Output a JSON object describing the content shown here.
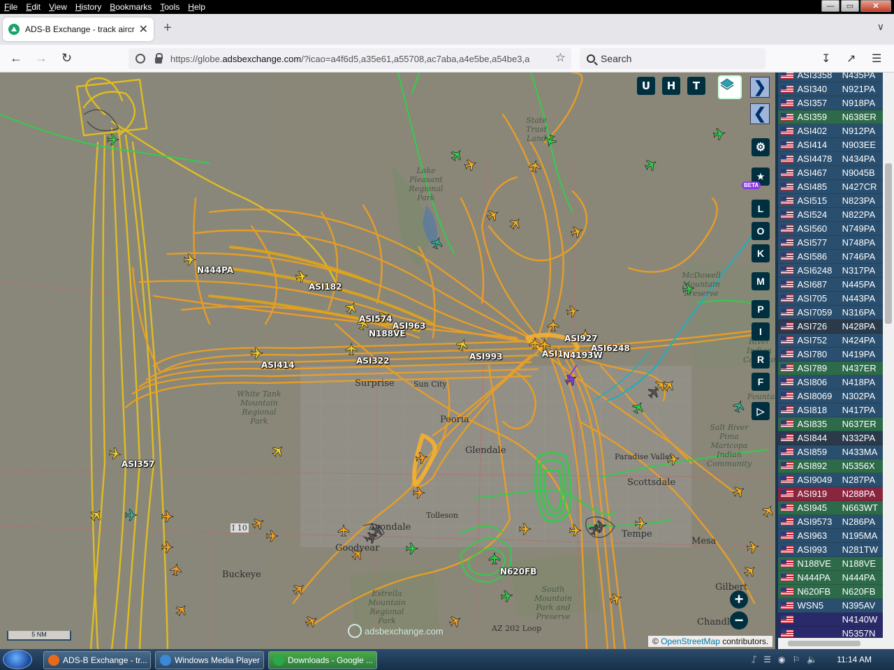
{
  "menubar": {
    "items": [
      "File",
      "Edit",
      "View",
      "History",
      "Bookmarks",
      "Tools",
      "Help"
    ]
  },
  "window_controls": {
    "minimize": "—",
    "maximize": "▭",
    "close": "✕"
  },
  "tab": {
    "title": "ADS-B Exchange - track aircraft",
    "close": "✕"
  },
  "newtab": "+",
  "navbar": {
    "url_prefix": "https://globe.",
    "url_domain": "adsbexchange.com",
    "url_rest": "/?icao=a4f6d5,a35e61,a55708,ac7aba,a4e5be,a54be3,a",
    "search_placeholder": "Search"
  },
  "map": {
    "places": [
      {
        "name": "Surprise",
        "cls": ""
      },
      {
        "name": "Glendale",
        "cls": ""
      },
      {
        "name": "Peoria",
        "cls": ""
      },
      {
        "name": "Scottsdale",
        "cls": ""
      },
      {
        "name": "Tempe",
        "cls": ""
      },
      {
        "name": "Mesa",
        "cls": ""
      },
      {
        "name": "Gilbert",
        "cls": ""
      },
      {
        "name": "Goodyear",
        "cls": ""
      },
      {
        "name": "Avondale",
        "cls": ""
      },
      {
        "name": "Tolleson",
        "cls": ""
      },
      {
        "name": "Buckeye",
        "cls": ""
      },
      {
        "name": "Chandler",
        "cls": ""
      },
      {
        "name": "Sun City",
        "cls": ""
      },
      {
        "name": "Paradise Valley",
        "cls": ""
      },
      {
        "name": "I 10",
        "cls": ""
      },
      {
        "name": "AZ 202 Loop",
        "cls": ""
      },
      {
        "name": "White Tank Mountain Regional Park",
        "cls": "small"
      },
      {
        "name": "Estrella Mountain Regional Park",
        "cls": "small"
      },
      {
        "name": "South Mountain Park and Preserve",
        "cls": "small"
      },
      {
        "name": "Salt River Pima Maricopa Indian Community",
        "cls": "small"
      },
      {
        "name": "McDowell Mountain Preserve",
        "cls": "small"
      },
      {
        "name": "State Trust Land",
        "cls": "small"
      },
      {
        "name": "Lake Pleasant Regional Park",
        "cls": "small"
      },
      {
        "name": "Gila River Indian Community",
        "cls": "small"
      },
      {
        "name": "Fountain Hills",
        "cls": "small"
      }
    ],
    "aircraft_labels": [
      "N444PA",
      "ASI182",
      "ASI574",
      "ASI963",
      "N188VE",
      "ASI993",
      "ASI322",
      "ASI414",
      "ASI357",
      "ASI6248",
      "ASI927",
      "ASI1",
      "N4193W",
      "N620FB"
    ],
    "top_buttons": [
      "U",
      "H",
      "T"
    ],
    "side_buttons": [
      "L",
      "O",
      "K",
      "M",
      "P",
      "I",
      "R",
      "F"
    ],
    "beta_badge": "BETA",
    "scale": "5 NM",
    "attribution_prefix": "© ",
    "attribution_link": "OpenStreetMap",
    "attribution_suffix": " contributors.",
    "watermark": "adsbexchange.com",
    "colors": {
      "track_orange": "#f5a623",
      "track_yellow": "#e6d21a",
      "track_green": "#2fcf4a",
      "selected": "#8a3ae0",
      "cyan": "#1ab0c0"
    }
  },
  "aircraft_list": [
    {
      "callsign": "ASI3358",
      "reg": "N435PA",
      "style": ""
    },
    {
      "callsign": "ASI340",
      "reg": "N921PA",
      "style": ""
    },
    {
      "callsign": "ASI357",
      "reg": "N918PA",
      "style": ""
    },
    {
      "callsign": "ASI359",
      "reg": "N638ER",
      "style": "green"
    },
    {
      "callsign": "ASI402",
      "reg": "N912PA",
      "style": ""
    },
    {
      "callsign": "ASI414",
      "reg": "N903EE",
      "style": ""
    },
    {
      "callsign": "ASI4478",
      "reg": "N434PA",
      "style": ""
    },
    {
      "callsign": "ASI467",
      "reg": "N9045B",
      "style": ""
    },
    {
      "callsign": "ASI485",
      "reg": "N427CR",
      "style": ""
    },
    {
      "callsign": "ASI515",
      "reg": "N823PA",
      "style": ""
    },
    {
      "callsign": "ASI524",
      "reg": "N822PA",
      "style": ""
    },
    {
      "callsign": "ASI560",
      "reg": "N749PA",
      "style": ""
    },
    {
      "callsign": "ASI577",
      "reg": "N748PA",
      "style": ""
    },
    {
      "callsign": "ASI586",
      "reg": "N746PA",
      "style": ""
    },
    {
      "callsign": "ASI6248",
      "reg": "N317PA",
      "style": ""
    },
    {
      "callsign": "ASI687",
      "reg": "N445PA",
      "style": ""
    },
    {
      "callsign": "ASI705",
      "reg": "N443PA",
      "style": ""
    },
    {
      "callsign": "ASI7059",
      "reg": "N316PA",
      "style": ""
    },
    {
      "callsign": "ASI726",
      "reg": "N428PA",
      "style": "dark"
    },
    {
      "callsign": "ASI752",
      "reg": "N424PA",
      "style": ""
    },
    {
      "callsign": "ASI780",
      "reg": "N419PA",
      "style": ""
    },
    {
      "callsign": "ASI789",
      "reg": "N437ER",
      "style": "green"
    },
    {
      "callsign": "ASI806",
      "reg": "N418PA",
      "style": ""
    },
    {
      "callsign": "ASI8069",
      "reg": "N302PA",
      "style": ""
    },
    {
      "callsign": "ASI818",
      "reg": "N417PA",
      "style": ""
    },
    {
      "callsign": "ASI835",
      "reg": "N637ER",
      "style": "green"
    },
    {
      "callsign": "ASI844",
      "reg": "N332PA",
      "style": "dark"
    },
    {
      "callsign": "ASI859",
      "reg": "N433MA",
      "style": ""
    },
    {
      "callsign": "ASI892",
      "reg": "N5356X",
      "style": "green"
    },
    {
      "callsign": "ASI9049",
      "reg": "N287PA",
      "style": ""
    },
    {
      "callsign": "ASI919",
      "reg": "N288PA",
      "style": "red"
    },
    {
      "callsign": "ASI945",
      "reg": "N663WT",
      "style": "green"
    },
    {
      "callsign": "ASI9573",
      "reg": "N286PA",
      "style": ""
    },
    {
      "callsign": "ASI963",
      "reg": "N195MA",
      "style": ""
    },
    {
      "callsign": "ASI993",
      "reg": "N281TW",
      "style": ""
    },
    {
      "callsign": "N188VE",
      "reg": "N188VE",
      "style": "green"
    },
    {
      "callsign": "N444PA",
      "reg": "N444PA",
      "style": "green"
    },
    {
      "callsign": "N620FB",
      "reg": "N620FB",
      "style": "green"
    },
    {
      "callsign": "WSN5",
      "reg": "N395AV",
      "style": ""
    },
    {
      "callsign": "",
      "reg": "N4140W",
      "style": "navy"
    },
    {
      "callsign": "",
      "reg": "N5357N",
      "style": "navy"
    }
  ],
  "taskbar": {
    "tasks": [
      {
        "label": "ADS-B Exchange - tr...",
        "color": "#e86a1a"
      },
      {
        "label": "Windows Media Player",
        "color": "#3a8ad8"
      },
      {
        "label": "Downloads - Google ...",
        "color": "#2aa84a"
      }
    ],
    "time": "11:14 AM"
  }
}
